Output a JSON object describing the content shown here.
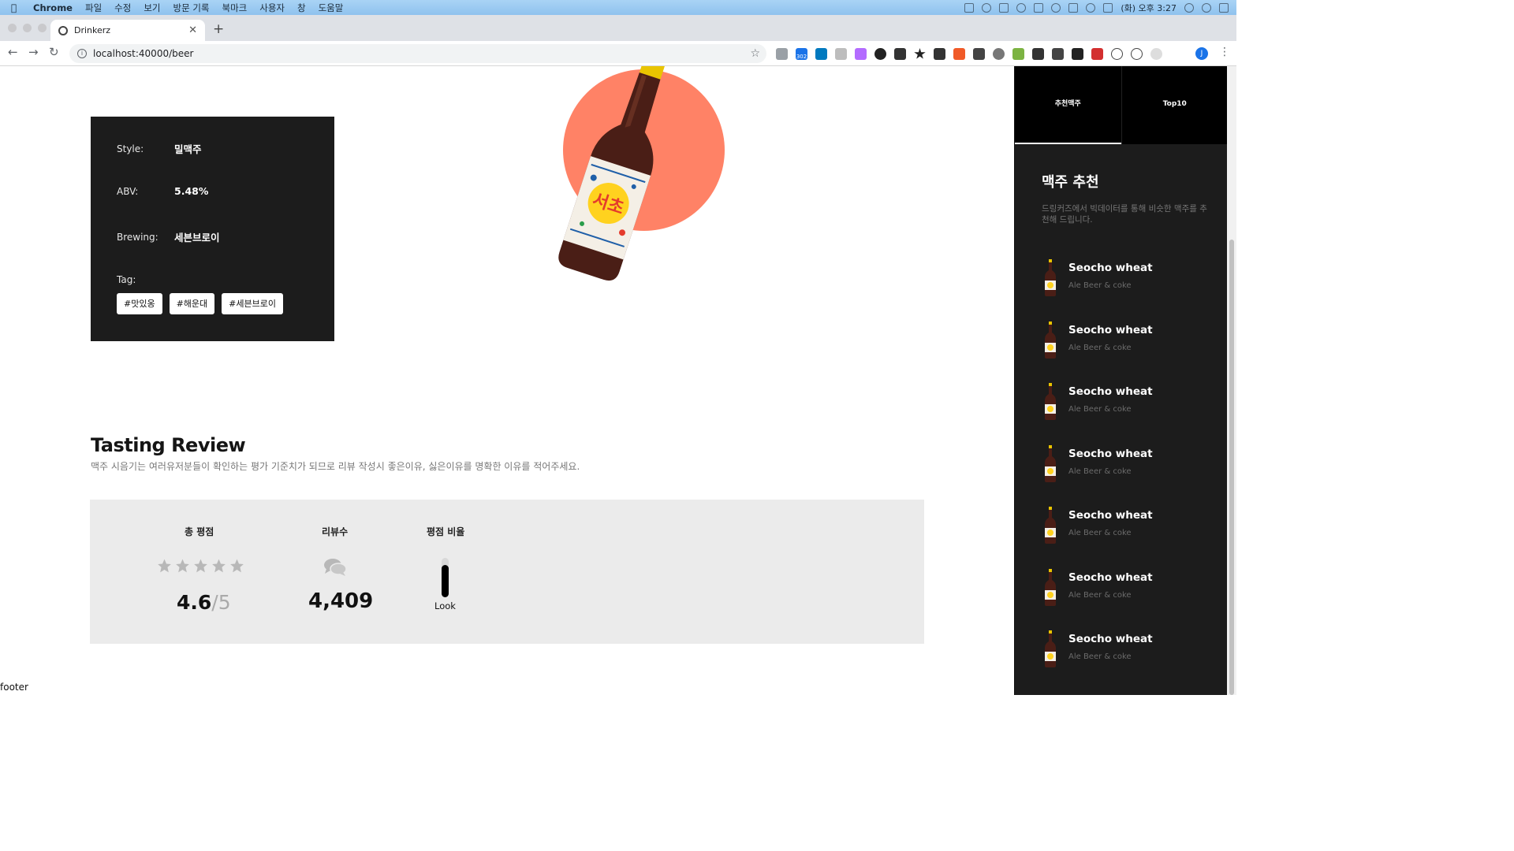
{
  "menubar": {
    "app": "Chrome",
    "items": [
      "파일",
      "수정",
      "보기",
      "방문 기록",
      "북마크",
      "사용자",
      "창",
      "도움말"
    ],
    "clock": "(화) 오후 3:27"
  },
  "browser": {
    "tab_title": "Drinkerz",
    "url": "localhost:40000/beer",
    "profile_initial": "J",
    "extension_badge": "302"
  },
  "beer_info": {
    "style_label": "Style:",
    "style_value": "밀맥주",
    "abv_label": "ABV:",
    "abv_value": "5.48%",
    "brewing_label": "Brewing:",
    "brewing_value": "세븐브로이",
    "tag_label": "Tag:",
    "tags": [
      "#맛있옹",
      "#해운대",
      "#세븐브로이"
    ]
  },
  "review": {
    "title": "Tasting Review",
    "subtitle": "맥주 시음기는 여러유저분들이 확인하는 평가 기준치가 되므로 리뷰 작성시 좋은이유, 싫은이유를 명확한 이유를 적어주세요.",
    "total_label": "총 평점",
    "score": "4.6",
    "score_max": "/5",
    "count_label": "리뷰수",
    "count": "4,409",
    "ratio_label": "평점 비율",
    "ratio_item": "Look",
    "ratio_fraction": 0.82
  },
  "footer": "footer",
  "sidebar": {
    "tab_recommend": "추천맥주",
    "tab_top": "Top10",
    "title": "맥주 추천",
    "description": "드링커즈에서 빅데이터를 통해 비슷한 맥주를 추천해 드립니다.",
    "items": [
      {
        "name": "Seocho wheat",
        "sub": "Ale Beer & coke"
      },
      {
        "name": "Seocho wheat",
        "sub": "Ale Beer & coke"
      },
      {
        "name": "Seocho wheat",
        "sub": "Ale Beer & coke"
      },
      {
        "name": "Seocho wheat",
        "sub": "Ale Beer & coke"
      },
      {
        "name": "Seocho wheat",
        "sub": "Ale Beer & coke"
      },
      {
        "name": "Seocho wheat",
        "sub": "Ale Beer & coke"
      },
      {
        "name": "Seocho wheat",
        "sub": "Ale Beer & coke"
      }
    ]
  },
  "colors": {
    "accent_circle": "#ff8266",
    "card_dark": "#1c1c1c",
    "stats_bg": "#ebebeb"
  },
  "icons": {
    "stars": "star-icon",
    "reviews": "chat-bubbles-icon",
    "bottle": "beer-bottle-icon"
  }
}
